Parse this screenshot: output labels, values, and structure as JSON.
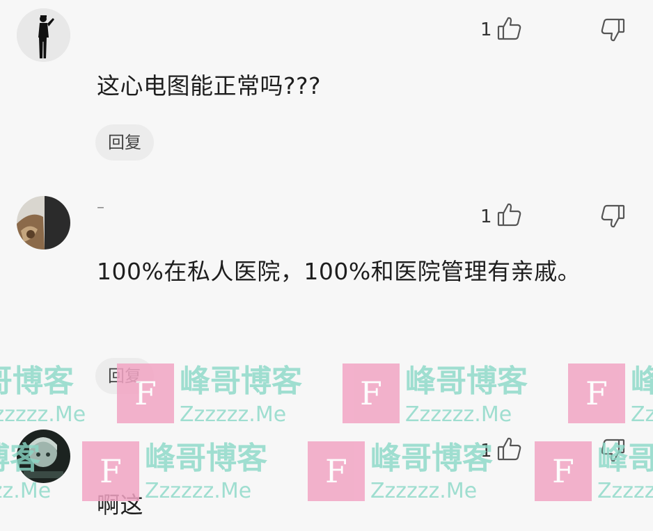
{
  "comments": [
    {
      "username": "",
      "likes": "1",
      "text": "这心电图能正常吗???",
      "reply_label": "回复"
    },
    {
      "username": "–",
      "likes": "1",
      "text": "100%在私人医院，100%和医院管理有亲戚。",
      "reply_label": "回复"
    },
    {
      "username": "",
      "likes": "1",
      "text": "啊这",
      "reply_label": ""
    }
  ],
  "watermark": {
    "logo_letter": "F",
    "title": "峰哥博客",
    "subtitle": "Zzzzzz.Me",
    "colors": {
      "box": "#f2a5c4",
      "text": "#8ad9c7"
    }
  },
  "icons": [
    "thumbs-up-icon",
    "thumbs-down-icon"
  ]
}
